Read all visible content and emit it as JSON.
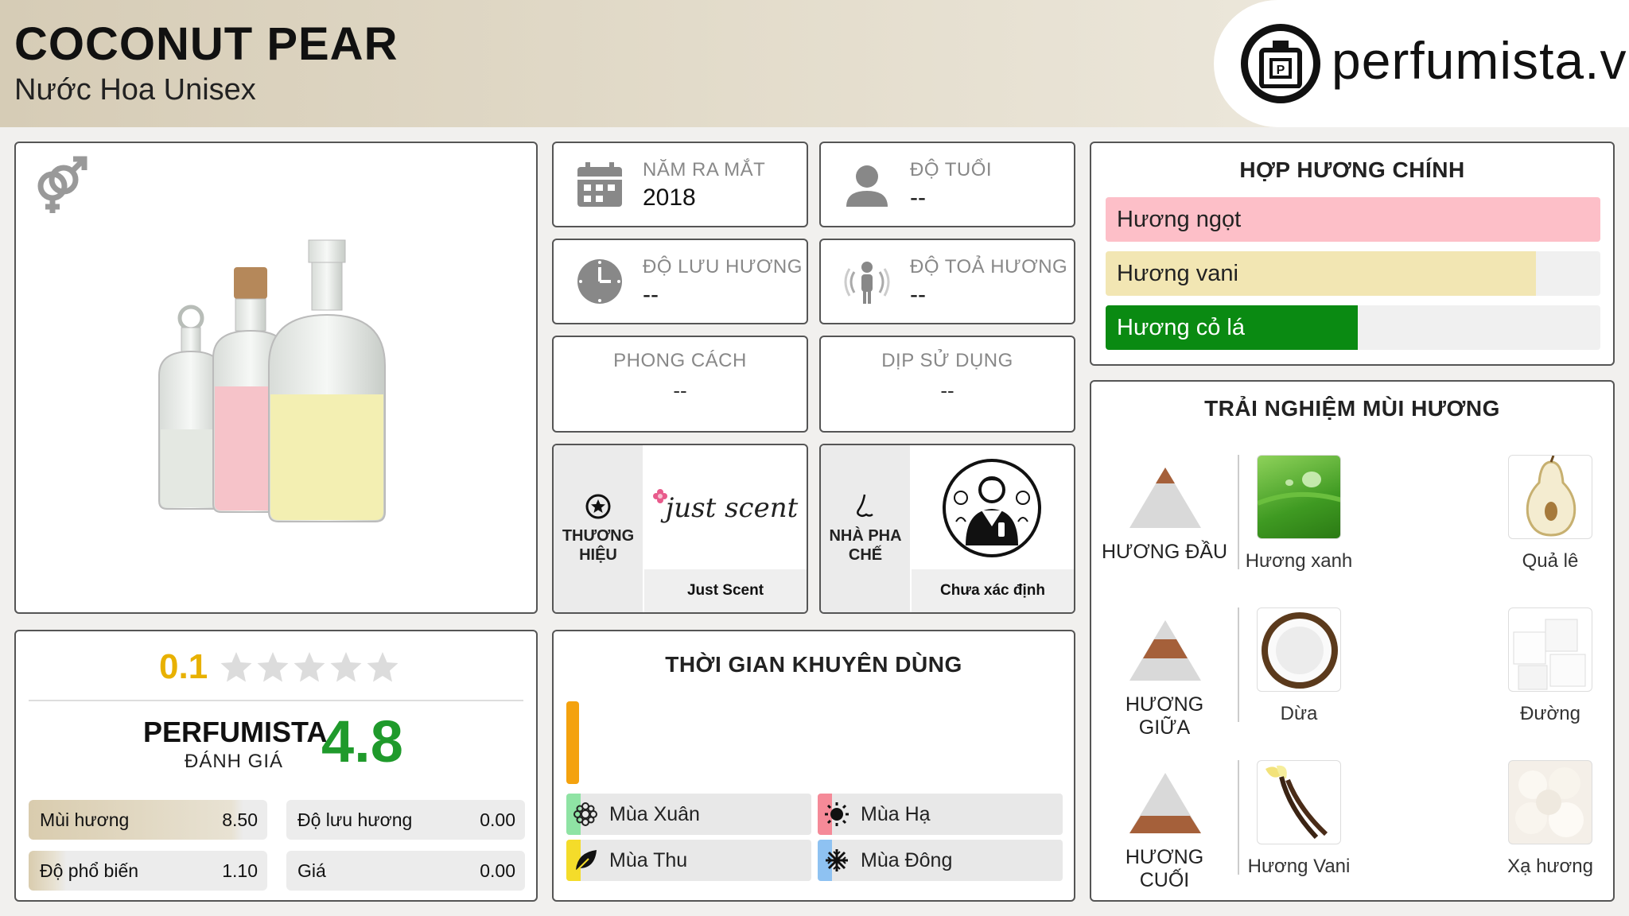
{
  "header": {
    "title": "COCONUT PEAR",
    "subtitle": "Nước Hoa Unisex",
    "logo_text": "perfumista.vn"
  },
  "info": {
    "release_year": {
      "label": "NĂM RA MẮT",
      "value": "2018"
    },
    "age": {
      "label": "ĐỘ TUỔI",
      "value": "--"
    },
    "longevity": {
      "label": "ĐỘ LƯU HƯƠNG",
      "value": "--"
    },
    "sillage": {
      "label": "ĐỘ TOẢ HƯƠNG",
      "value": "--"
    },
    "style": {
      "label": "PHONG CÁCH",
      "value": "--"
    },
    "occasion": {
      "label": "DỊP SỬ DỤNG",
      "value": "--"
    },
    "brand": {
      "label_line1": "THƯƠNG",
      "label_line2": "HIỆU",
      "name": "Just Scent",
      "logo_text": "just scent"
    },
    "perfumer": {
      "label_line1": "NHÀ PHA",
      "label_line2": "CHẾ",
      "name": "Chưa xác định"
    }
  },
  "accords": {
    "title": "HỢP HƯƠNG CHÍNH",
    "items": [
      {
        "label": "Hương ngọt",
        "color": "#fdbfc8",
        "fraction": 1.0
      },
      {
        "label": "Hương vani",
        "color": "#f2e6b3",
        "fraction": 0.87
      },
      {
        "label": "Hương cỏ lá",
        "color": "#0a8a12",
        "fraction": 0.51
      }
    ]
  },
  "notes": {
    "title": "TRẢI NGHIỆM MÙI HƯƠNG",
    "rows": [
      {
        "tier": "HƯƠNG ĐẦU",
        "items": [
          "Hương xanh",
          "Quả lê"
        ]
      },
      {
        "tier": "HƯƠNG GIỮA",
        "items": [
          "Dừa",
          "Đường"
        ]
      },
      {
        "tier": "HƯƠNG CUỐI",
        "items": [
          "Hương Vani",
          "Xạ hương"
        ]
      }
    ]
  },
  "rating": {
    "user_score": "0.1",
    "stars_filled": 0,
    "stars_total": 5,
    "perfumista_label": "PERFUMISTA",
    "perfumista_sub": "ĐÁNH GIÁ",
    "perfumista_score": "4.8",
    "metrics": [
      {
        "label": "Mùi hương",
        "value": "8.50",
        "fraction": 0.85
      },
      {
        "label": "Độ lưu hương",
        "value": "0.00",
        "fraction": 0
      },
      {
        "label": "Độ phổ biến",
        "value": "1.10",
        "fraction": 0.11
      },
      {
        "label": "Giá",
        "value": "0.00",
        "fraction": 0
      }
    ]
  },
  "time": {
    "title": "THỜI GIAN KHUYÊN DÙNG",
    "seasons": [
      {
        "label": "Mùa Xuân",
        "color": "#8fe3a4"
      },
      {
        "label": "Mùa Hạ",
        "color": "#f58a98"
      },
      {
        "label": "Mùa Thu",
        "color": "#f4dc2a"
      },
      {
        "label": "Mùa Đông",
        "color": "#8ec2f2"
      }
    ]
  }
}
